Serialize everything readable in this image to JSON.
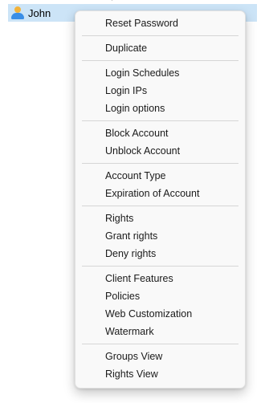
{
  "tree": {
    "selected_user": "John"
  },
  "menu": {
    "groups": [
      {
        "items": [
          "Reset Password"
        ]
      },
      {
        "items": [
          "Duplicate"
        ]
      },
      {
        "items": [
          "Login Schedules",
          "Login IPs",
          "Login options"
        ]
      },
      {
        "items": [
          "Block Account",
          "Unblock Account"
        ]
      },
      {
        "items": [
          "Account Type",
          "Expiration of Account"
        ]
      },
      {
        "items": [
          "Rights",
          "Grant rights",
          "Deny rights"
        ]
      },
      {
        "items": [
          "Client Features",
          "Policies",
          "Web Customization",
          "Watermark"
        ]
      },
      {
        "items": [
          "Groups View",
          "Rights View"
        ]
      }
    ]
  },
  "colors": {
    "selection": "#cce4f7",
    "menu_background": "#f9f9f9",
    "separator": "#d6d6d6"
  },
  "icons": {
    "user": "user-icon"
  }
}
